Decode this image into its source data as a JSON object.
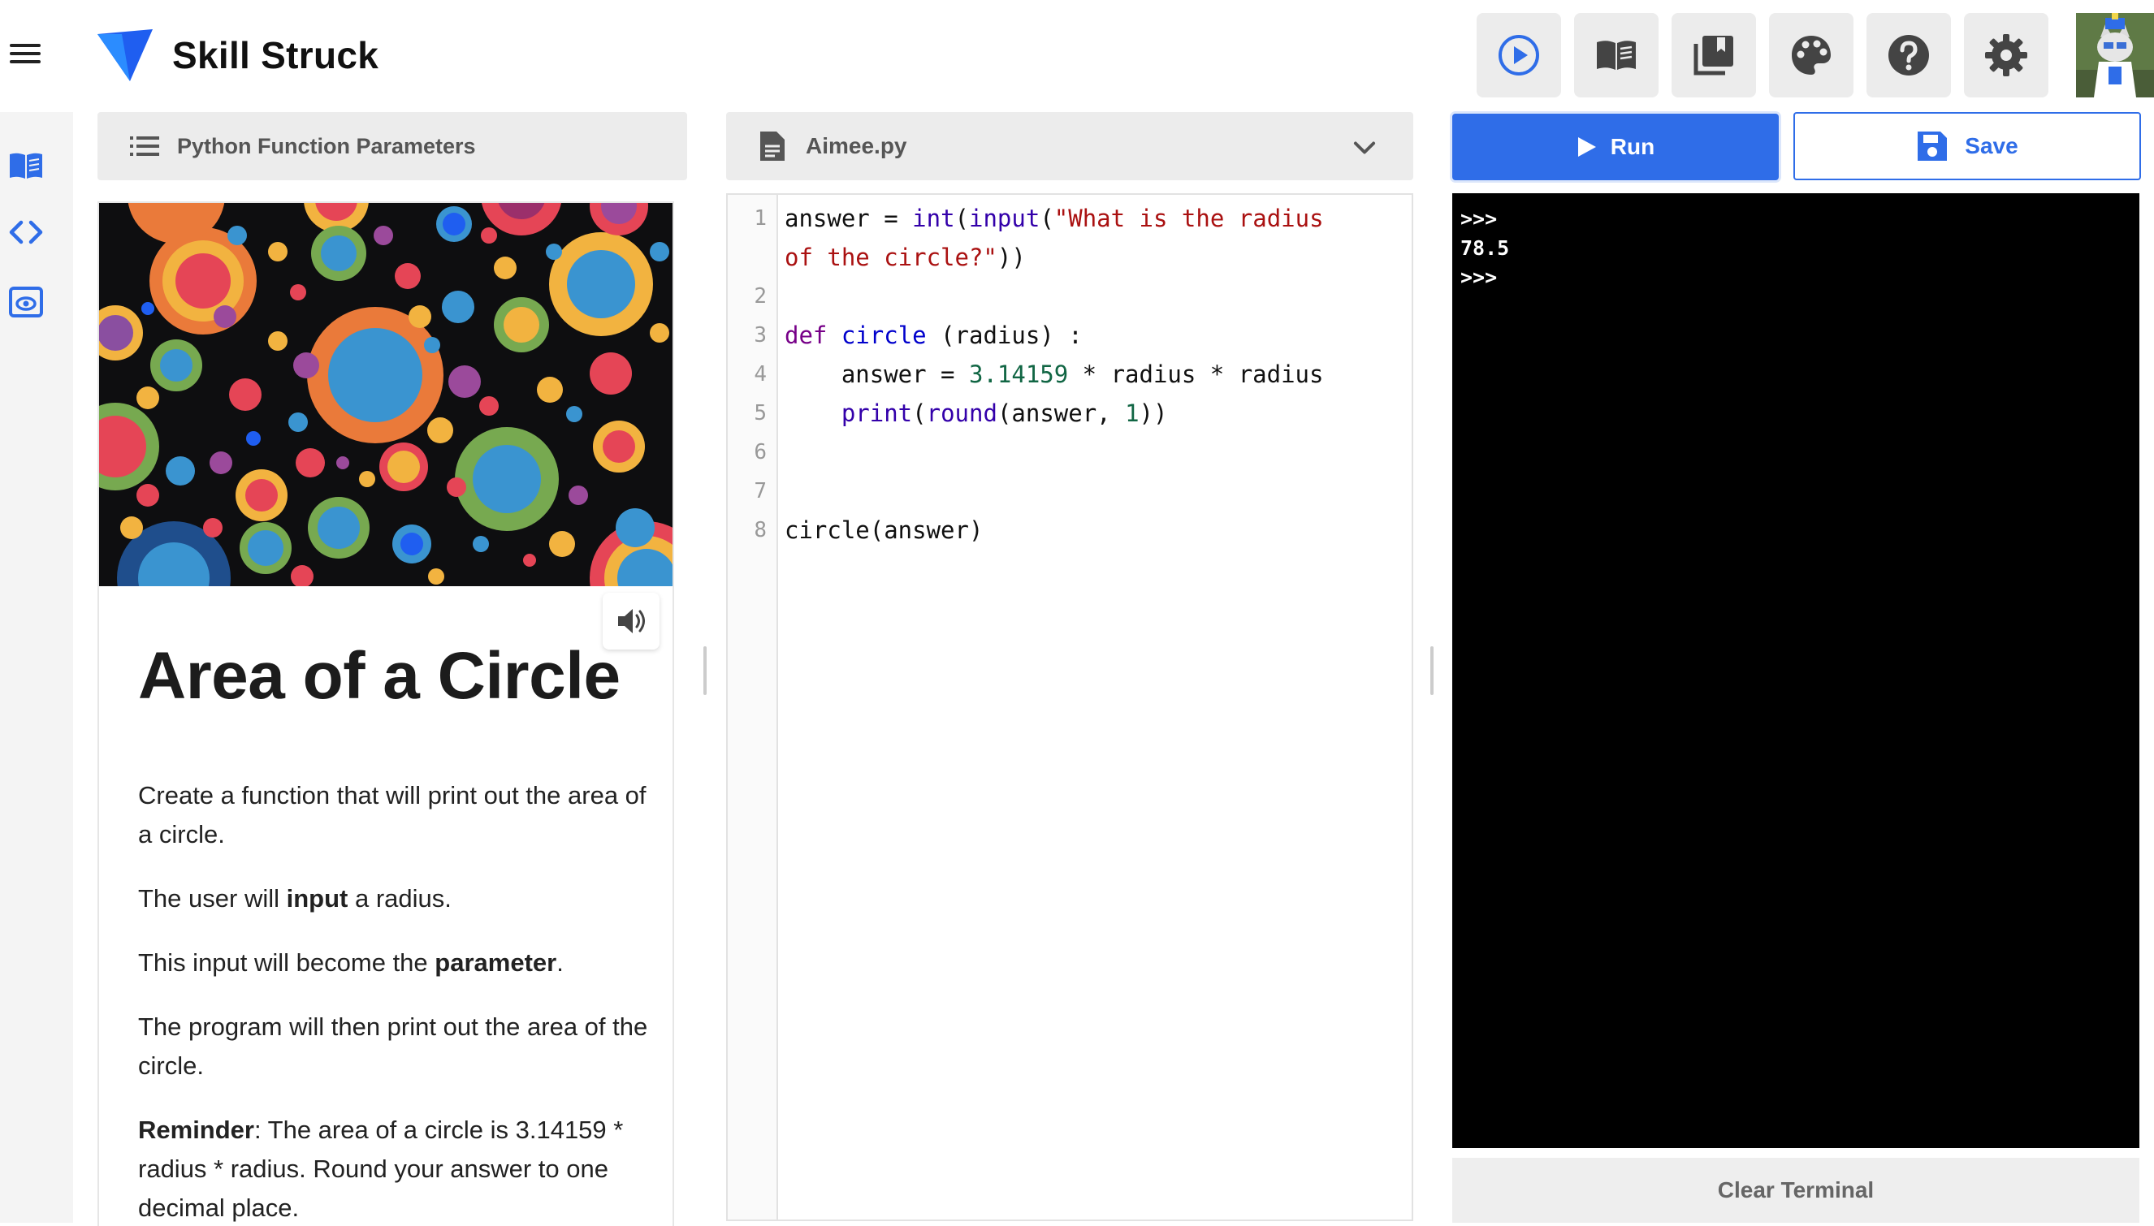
{
  "app": {
    "name": "Skill Struck",
    "accent": "#2f6de8"
  },
  "toolbar": {
    "items": [
      {
        "icon": "play-circle-icon"
      },
      {
        "icon": "open-book-icon"
      },
      {
        "icon": "library-icon"
      },
      {
        "icon": "palette-icon"
      },
      {
        "icon": "help-icon"
      },
      {
        "icon": "gear-icon"
      }
    ]
  },
  "rail": {
    "items": [
      {
        "icon": "lesson-book-icon"
      },
      {
        "icon": "code-icon"
      },
      {
        "icon": "preview-eye-icon"
      }
    ]
  },
  "lesson": {
    "header": "Python Function Parameters",
    "heading": "Area of a Circle",
    "paragraphs": {
      "p1": "Create a function that will print out the area of a circle.",
      "p2_pre": "The user will ",
      "p2_bold": "input",
      "p2_post": " a radius.",
      "p3_pre": "This input will become the ",
      "p3_bold": "parameter",
      "p3_post": ".",
      "p4": "The program will then print out the area of the circle.",
      "p5_bold": "Reminder",
      "p5_post": ": The area of a circle is 3.14159 * radius * radius. Round your answer to one decimal place."
    }
  },
  "editor": {
    "file_name": "Aimee.py",
    "line_numbers": [
      "1",
      "2",
      "3",
      "4",
      "5",
      "6",
      "7",
      "8"
    ],
    "code": {
      "l1a_var": "answer",
      "l1a_eq": " = ",
      "l1a_int": "int",
      "l1a_p1": "(",
      "l1a_input": "input",
      "l1a_p2": "(",
      "l1a_str": "\"What is the radius",
      "l1b_str": "of the circle?\"",
      "l1b_close": "))",
      "l3_def": "def",
      "l3_sp": " ",
      "l3_name": "circle",
      "l3_rest": " (radius) :",
      "l4_indent": "    answer = ",
      "l4_num": "3.14159",
      "l4_rest": " * radius * radius",
      "l5_indent": "    ",
      "l5_print": "print",
      "l5_p": "(",
      "l5_round": "round",
      "l5_args": "(answer, ",
      "l5_num": "1",
      "l5_close": "))",
      "l8": "circle(answer)"
    }
  },
  "actions": {
    "run_label": "Run",
    "save_label": "Save",
    "clear_label": "Clear Terminal"
  },
  "terminal": {
    "lines": [
      ">>>",
      "78.5",
      ">>>"
    ]
  }
}
